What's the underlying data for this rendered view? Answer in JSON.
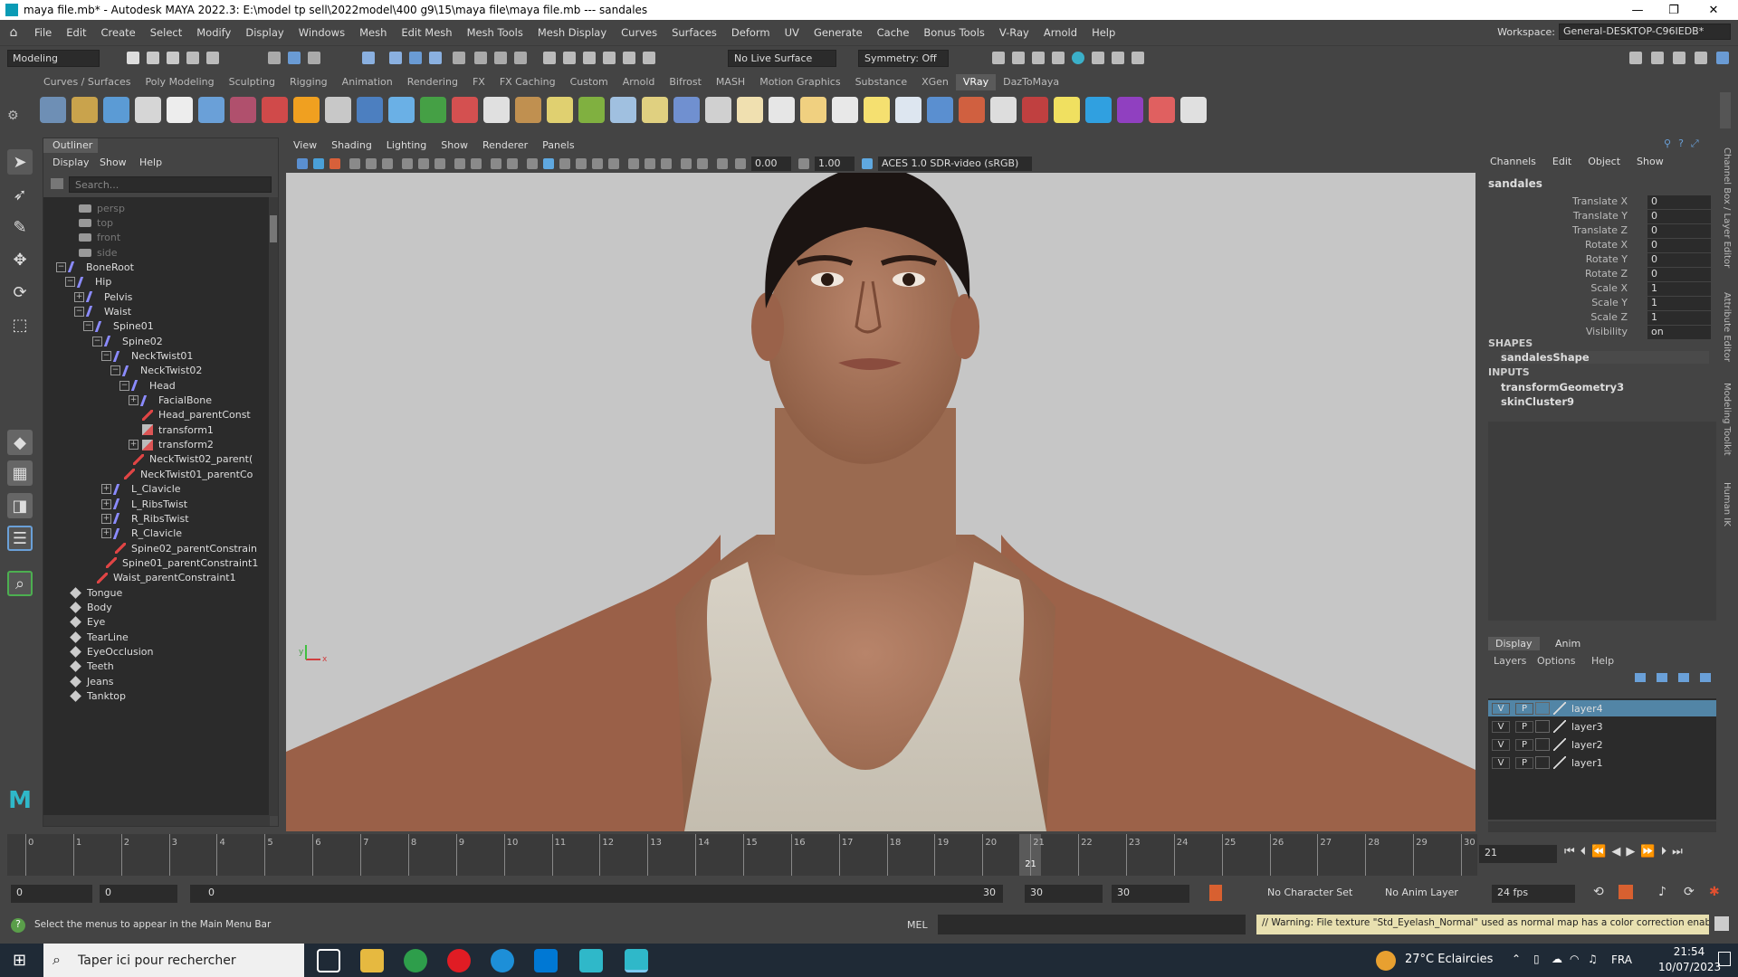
{
  "window": {
    "title": "maya file.mb* - Autodesk MAYA 2022.3: E:\\model tp sell\\2022model\\400 g9\\15\\maya file\\maya file.mb  ---  sandales",
    "minimize": "—",
    "maximize": "❐",
    "close": "✕"
  },
  "menubar": {
    "items": [
      "File",
      "Edit",
      "Create",
      "Select",
      "Modify",
      "Display",
      "Windows",
      "Mesh",
      "Edit Mesh",
      "Mesh Tools",
      "Mesh Display",
      "Curves",
      "Surfaces",
      "Deform",
      "UV",
      "Generate",
      "Cache",
      "Bonus Tools",
      "V-Ray",
      "Arnold",
      "Help"
    ],
    "workspace_label": "Workspace:",
    "workspace_value": "General-DESKTOP-C96IEDB*"
  },
  "statusline": {
    "mode": "Modeling",
    "live_surface": "No Live Surface",
    "symmetry": "Symmetry: Off"
  },
  "shelf": {
    "tabs": [
      "Curves / Surfaces",
      "Poly Modeling",
      "Sculpting",
      "Rigging",
      "Animation",
      "Rendering",
      "FX",
      "FX Caching",
      "Custom",
      "Arnold",
      "Bifrost",
      "MASH",
      "Motion Graphics",
      "Substance",
      "XGen",
      "VRay",
      "DazToMaya"
    ],
    "active_tab": "VRay",
    "icon_colors": [
      "#6e8fb5",
      "#c9a34c",
      "#5b9bd5",
      "#d6d6d6",
      "#ededed",
      "#6aa0d8",
      "#b0506d",
      "#d04a4a",
      "#f0a020",
      "#c8c8c8",
      "#4c7fc0",
      "#6ab0e6",
      "#45a045",
      "#d45050",
      "#e0e0e0",
      "#c09050",
      "#e0d070",
      "#80b040",
      "#a0c0e0",
      "#e0d080",
      "#7090d0",
      "#d0d0d0",
      "#f0e0b0",
      "#e6e6e6",
      "#f0d080",
      "#e8e8e8",
      "#f5e070",
      "#dde6f0",
      "#5a8fd0",
      "#d06040",
      "#dddddd",
      "#c04040",
      "#f0e060",
      "#30a0e0",
      "#9040c0",
      "#e06060",
      "#e0e0e0"
    ]
  },
  "outliner": {
    "title": "Outliner",
    "menu": [
      "Display",
      "Show",
      "Help"
    ],
    "search_placeholder": "Search...",
    "nodes": [
      {
        "label": "persp",
        "icon": "camera-icon",
        "depth": 2,
        "dim": true,
        "expander": ""
      },
      {
        "label": "top",
        "icon": "camera-icon",
        "depth": 2,
        "dim": true,
        "expander": ""
      },
      {
        "label": "front",
        "icon": "camera-icon",
        "depth": 2,
        "dim": true,
        "expander": ""
      },
      {
        "label": "side",
        "icon": "camera-icon",
        "depth": 2,
        "dim": true,
        "expander": ""
      },
      {
        "label": "BoneRoot",
        "icon": "joint-icon",
        "depth": 1,
        "dim": false,
        "expander": "−"
      },
      {
        "label": "Hip",
        "icon": "joint-icon",
        "depth": 2,
        "dim": false,
        "expander": "−"
      },
      {
        "label": "Pelvis",
        "icon": "joint-icon",
        "depth": 3,
        "dim": false,
        "expander": "+"
      },
      {
        "label": "Waist",
        "icon": "joint-icon",
        "depth": 3,
        "dim": false,
        "expander": "−"
      },
      {
        "label": "Spine01",
        "icon": "joint-icon",
        "depth": 4,
        "dim": false,
        "expander": "−"
      },
      {
        "label": "Spine02",
        "icon": "joint-icon",
        "depth": 5,
        "dim": false,
        "expander": "−"
      },
      {
        "label": "NeckTwist01",
        "icon": "joint-icon",
        "depth": 6,
        "dim": false,
        "expander": "−"
      },
      {
        "label": "NeckTwist02",
        "icon": "joint-icon",
        "depth": 7,
        "dim": false,
        "expander": "−"
      },
      {
        "label": "Head",
        "icon": "joint-icon",
        "depth": 8,
        "dim": false,
        "expander": "−"
      },
      {
        "label": "FacialBone",
        "icon": "joint-icon",
        "depth": 9,
        "dim": false,
        "expander": "+"
      },
      {
        "label": "Head_parentConst",
        "icon": "constraint-icon",
        "depth": 9,
        "dim": false,
        "expander": ""
      },
      {
        "label": "transform1",
        "icon": "transform-icon",
        "depth": 9,
        "dim": false,
        "expander": ""
      },
      {
        "label": "transform2",
        "icon": "transform-icon",
        "depth": 9,
        "dim": false,
        "expander": "+"
      },
      {
        "label": "NeckTwist02_parent(",
        "icon": "constraint-icon",
        "depth": 8,
        "dim": false,
        "expander": ""
      },
      {
        "label": "NeckTwist01_parentCo",
        "icon": "constraint-icon",
        "depth": 7,
        "dim": false,
        "expander": ""
      },
      {
        "label": "L_Clavicle",
        "icon": "joint-icon",
        "depth": 6,
        "dim": false,
        "expander": "+"
      },
      {
        "label": "L_RibsTwist",
        "icon": "joint-icon",
        "depth": 6,
        "dim": false,
        "expander": "+"
      },
      {
        "label": "R_RibsTwist",
        "icon": "joint-icon",
        "depth": 6,
        "dim": false,
        "expander": "+"
      },
      {
        "label": "R_Clavicle",
        "icon": "joint-icon",
        "depth": 6,
        "dim": false,
        "expander": "+"
      },
      {
        "label": "Spine02_parentConstrain",
        "icon": "constraint-icon",
        "depth": 6,
        "dim": false,
        "expander": ""
      },
      {
        "label": "Spine01_parentConstraint1",
        "icon": "constraint-icon",
        "depth": 5,
        "dim": false,
        "expander": ""
      },
      {
        "label": "Waist_parentConstraint1",
        "icon": "constraint-icon",
        "depth": 4,
        "dim": false,
        "expander": ""
      },
      {
        "label": "Tongue",
        "icon": "mesh-icon",
        "depth": 1,
        "dim": false,
        "expander": ""
      },
      {
        "label": "Body",
        "icon": "mesh-icon",
        "depth": 1,
        "dim": false,
        "expander": ""
      },
      {
        "label": "Eye",
        "icon": "mesh-icon",
        "depth": 1,
        "dim": false,
        "expander": ""
      },
      {
        "label": "TearLine",
        "icon": "mesh-icon",
        "depth": 1,
        "dim": false,
        "expander": ""
      },
      {
        "label": "EyeOcclusion",
        "icon": "mesh-icon",
        "depth": 1,
        "dim": false,
        "expander": ""
      },
      {
        "label": "Teeth",
        "icon": "mesh-icon",
        "depth": 1,
        "dim": false,
        "expander": ""
      },
      {
        "label": "Jeans",
        "icon": "mesh-icon",
        "depth": 1,
        "dim": false,
        "expander": ""
      },
      {
        "label": "Tanktop",
        "icon": "mesh-icon",
        "depth": 1,
        "dim": false,
        "expander": ""
      }
    ]
  },
  "viewport": {
    "menu": [
      "View",
      "Shading",
      "Lighting",
      "Show",
      "Renderer",
      "Panels"
    ],
    "exposure": "0.00",
    "gamma": "1.00",
    "color_space": "ACES 1.0 SDR-video (sRGB)",
    "axis_x": "x",
    "axis_y": "y"
  },
  "channelbox": {
    "menu": [
      "Channels",
      "Edit",
      "Object",
      "Show"
    ],
    "object": "sandales",
    "attributes": [
      {
        "name": "Translate X",
        "value": "0"
      },
      {
        "name": "Translate Y",
        "value": "0"
      },
      {
        "name": "Translate Z",
        "value": "0"
      },
      {
        "name": "Rotate X",
        "value": "0"
      },
      {
        "name": "Rotate Y",
        "value": "0"
      },
      {
        "name": "Rotate Z",
        "value": "0"
      },
      {
        "name": "Scale X",
        "value": "1"
      },
      {
        "name": "Scale Y",
        "value": "1"
      },
      {
        "name": "Scale Z",
        "value": "1"
      },
      {
        "name": "Visibility",
        "value": "on"
      }
    ],
    "shapes_heading": "SHAPES",
    "shape": "sandalesShape",
    "inputs_heading": "INPUTS",
    "inputs": [
      "transformGeometry3",
      "skinCluster9"
    ]
  },
  "side_tabs": [
    "Channel Box / Layer Editor",
    "Attribute Editor",
    "Modeling Toolkit",
    "Human IK"
  ],
  "layer_editor": {
    "tabs": [
      "Display",
      "Anim"
    ],
    "menu": [
      "Layers",
      "Options",
      "Help"
    ],
    "layers": [
      {
        "v": "V",
        "p": "P",
        "name": "layer4",
        "selected": true
      },
      {
        "v": "V",
        "p": "P",
        "name": "layer3",
        "selected": false
      },
      {
        "v": "V",
        "p": "P",
        "name": "layer2",
        "selected": false
      },
      {
        "v": "V",
        "p": "P",
        "name": "layer1",
        "selected": false
      }
    ]
  },
  "timeline": {
    "start": 0,
    "end": 30,
    "current_frame": "21",
    "frame_field": "21"
  },
  "range": {
    "anim_start": "0",
    "play_start": "0",
    "slider_start": "0",
    "slider_end": "30",
    "play_end": "30",
    "anim_end": "30",
    "character_set": "No Character Set",
    "anim_layer": "No Anim Layer",
    "fps": "24 fps"
  },
  "helpline": {
    "help_text": "Select the menus to appear in the Main Menu Bar",
    "mel_label": "MEL",
    "warning": "// Warning: File texture \"Std_Eyelash_Normal\" used as normal map has a color correction enable"
  },
  "taskbar": {
    "search_placeholder": "Taper ici pour rechercher",
    "weather": "27°C  Eclaircies",
    "language": "FRA",
    "time": "21:54",
    "date": "10/07/2023"
  }
}
